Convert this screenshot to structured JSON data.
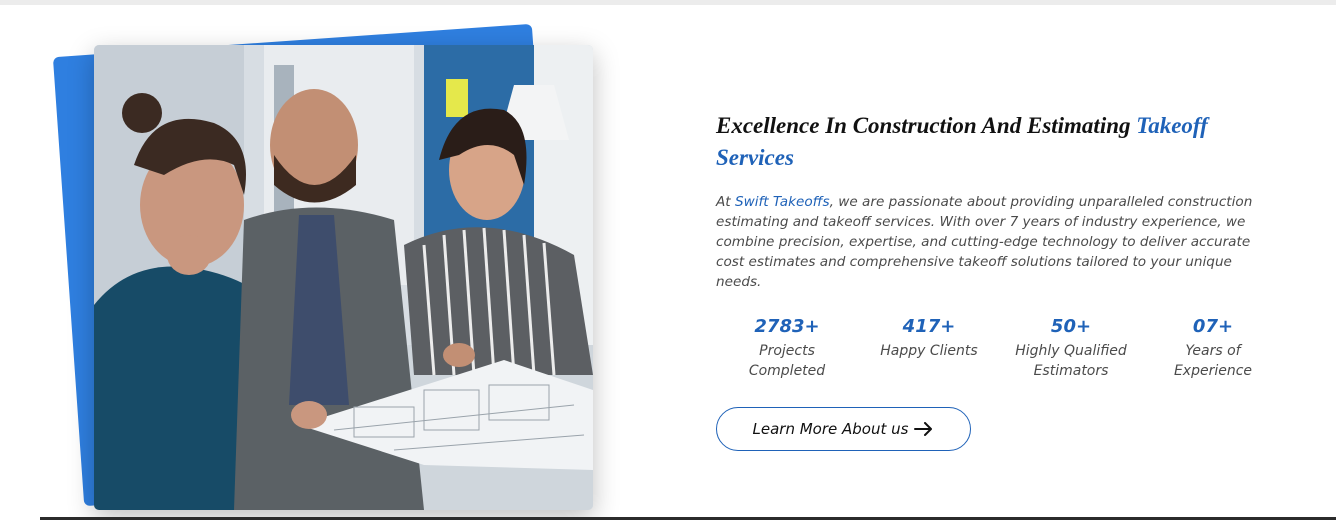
{
  "section": {
    "heading_main": "Excellence In Construction And Estimating",
    "heading_accent": "Takeoff Services",
    "intro_prefix": "At",
    "brand_name": "Swift Takeoffs",
    "intro_rest": ", we are passionate about providing unparalleled construction estimating and takeoff services. With over 7 years of industry experience, we combine precision, expertise, and cutting-edge technology to deliver accurate cost estimates and comprehensive takeoff solutions tailored to your unique needs.",
    "accent_color": "#1f62b8"
  },
  "stats": [
    {
      "value": "2783+",
      "label_line1": "Projects",
      "label_line2": "Completed"
    },
    {
      "value": "417+",
      "label_line1": "Happy Clients",
      "label_line2": ""
    },
    {
      "value": "50+",
      "label_line1": "Highly Qualified",
      "label_line2": "Estimators"
    },
    {
      "value": "07+",
      "label_line1": "Years of",
      "label_line2": "Experience"
    }
  ],
  "cta": {
    "label": "Learn More About us",
    "icon": "arrow-right-icon"
  },
  "media": {
    "photo": "team-reviewing-blueprints-photo",
    "card_color": "#2f7fe0"
  }
}
